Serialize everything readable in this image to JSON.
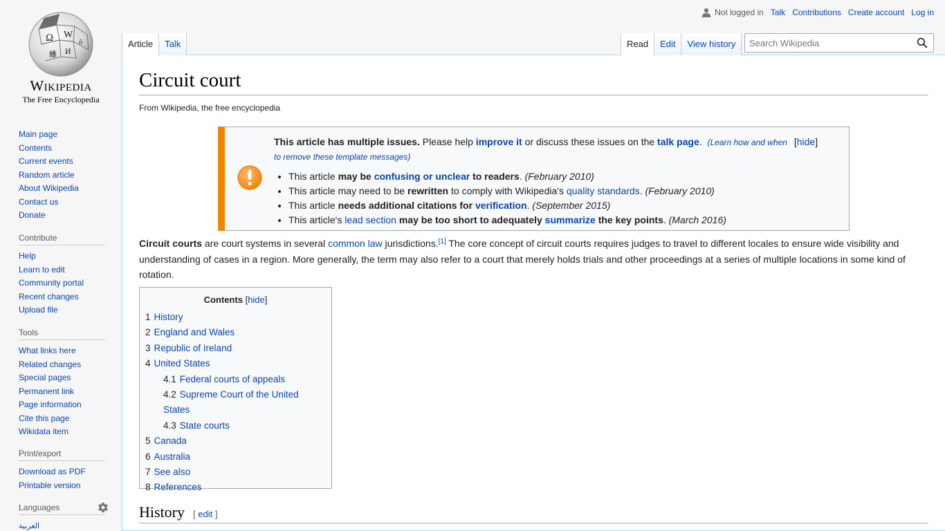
{
  "personal": {
    "not_logged_in": "Not logged in",
    "talk": "Talk",
    "contributions": "Contributions",
    "create_account": "Create account",
    "log_in": "Log in"
  },
  "logo": {
    "wordmark": "Wikipedia",
    "tagline": "The Free Encyclopedia"
  },
  "tabs": {
    "article": "Article",
    "talk": "Talk",
    "read": "Read",
    "edit": "Edit",
    "view_history": "View history"
  },
  "search": {
    "placeholder": "Search Wikipedia",
    "value": ""
  },
  "sidebar": {
    "navigation": [
      "Main page",
      "Contents",
      "Current events",
      "Random article",
      "About Wikipedia",
      "Contact us",
      "Donate"
    ],
    "contribute": {
      "heading": "Contribute",
      "items": [
        "Help",
        "Learn to edit",
        "Community portal",
        "Recent changes",
        "Upload file"
      ]
    },
    "tools": {
      "heading": "Tools",
      "items": [
        "What links here",
        "Related changes",
        "Special pages",
        "Permanent link",
        "Page information",
        "Cite this page",
        "Wikidata item"
      ]
    },
    "print": {
      "heading": "Print/export",
      "items": [
        "Download as PDF",
        "Printable version"
      ]
    },
    "languages": {
      "heading": "Languages",
      "items": [
        "العربية"
      ]
    }
  },
  "article": {
    "title": "Circuit court",
    "site_sub": "From Wikipedia, the free encyclopedia",
    "ambox": {
      "lead_bold": "This article has multiple issues.",
      "lead_text1": " Please help ",
      "improve": "improve it",
      "lead_text2": " or discuss these issues on the ",
      "talk_page": "talk page",
      "lead_text3": ".",
      "learn": "(Learn how and when to remove these template messages)",
      "learn_part1": "(Learn how and when",
      "learn_part2": "to remove these template messages)",
      "hide": "[hide]",
      "issues": [
        {
          "pre": "This article ",
          "bold1": "may be ",
          "link": "confusing or unclear",
          "bold2": " to readers",
          "post": ".",
          "date": "(February 2010)"
        },
        {
          "pre": "This article may need to be ",
          "bold1": "rewritten",
          "mid": " to comply with Wikipedia's ",
          "link": "quality standards",
          "post": ".",
          "date": "(February 2010)"
        },
        {
          "pre": "This article ",
          "bold1": "needs additional citations for ",
          "link": "verification",
          "post": ".",
          "date": "(September 2015)"
        },
        {
          "pre": "This article's ",
          "link": "lead section",
          "bold1": " may be too short to adequately ",
          "link2": "summarize",
          "bold2": " the key points",
          "post": ".",
          "date": "(March 2016)"
        }
      ]
    },
    "intro": {
      "bold": "Circuit courts",
      "t1": " are court systems in several ",
      "link": "common law",
      "t2": " jurisdictions.",
      "ref": "[1]",
      "t3": " The core concept of circuit courts requires judges to travel to different locales to ensure wide visibility and understanding of cases in a region. More generally, the term may also refer to a court that merely holds trials and other proceedings at a series of multiple locations in some kind of rotation."
    },
    "toc": {
      "title": "Contents",
      "hide": "hide",
      "items": [
        {
          "num": "1",
          "label": "History",
          "sub": false
        },
        {
          "num": "2",
          "label": "England and Wales",
          "sub": false
        },
        {
          "num": "3",
          "label": "Republic of Ireland",
          "sub": false
        },
        {
          "num": "4",
          "label": "United States",
          "sub": false
        },
        {
          "num": "4.1",
          "label": "Federal courts of appeals",
          "sub": true
        },
        {
          "num": "4.2",
          "label": "Supreme Court of the United States",
          "sub": true
        },
        {
          "num": "4.3",
          "label": "State courts",
          "sub": true
        },
        {
          "num": "5",
          "label": "Canada",
          "sub": false
        },
        {
          "num": "6",
          "label": "Australia",
          "sub": false
        },
        {
          "num": "7",
          "label": "See also",
          "sub": false
        },
        {
          "num": "8",
          "label": "References",
          "sub": false
        }
      ]
    },
    "section_history": {
      "title": "History",
      "edit": "edit"
    }
  },
  "colors": {
    "link": "#0645ad",
    "ambox_border": "#f28500",
    "warning_icon": "#f28500"
  }
}
